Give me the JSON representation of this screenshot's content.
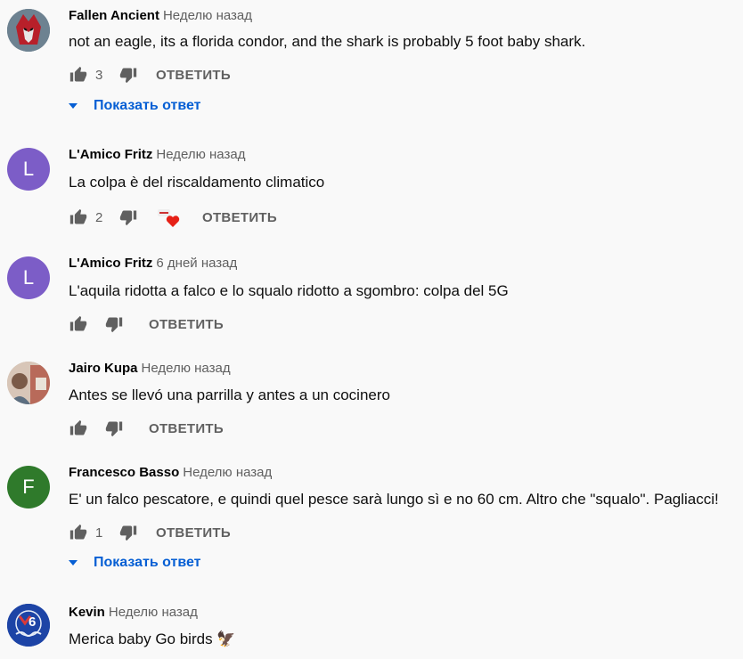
{
  "comments": [
    {
      "author": "Fallen Ancient",
      "time": "Неделю назад",
      "text": "not an eagle, its a florida condor, and the shark is probably 5 foot baby shark.",
      "likes": "3",
      "reply_label": "ОТВЕТИТЬ",
      "show_replies": "Показать ответ",
      "avatar_icon": "robot-mask-avatar-icon"
    },
    {
      "author": "L'Amico Fritz",
      "time": "Неделю назад",
      "text": "La colpa è del riscaldamento climatico",
      "likes": "2",
      "reply_label": "ОТВЕТИТЬ",
      "avatar_letter": "L",
      "avatar_color": "#7c5dc7",
      "creator_heart": true
    },
    {
      "author": "L'Amico Fritz",
      "time": "6 дней назад",
      "text": "L'aquila ridotta a falco e lo squalo ridotto a sgombro: colpa del 5G",
      "likes": "",
      "reply_label": "ОТВЕТИТЬ",
      "avatar_letter": "L",
      "avatar_color": "#7c5dc7"
    },
    {
      "author": "Jairo Kupa",
      "time": "Неделю назад",
      "text": "Antes se llevó una parrilla y antes a un cocinero",
      "likes": "",
      "reply_label": "ОТВЕТИТЬ",
      "avatar_icon": "photo-avatar-icon"
    },
    {
      "author": "Francesco Basso",
      "time": "Неделю назад",
      "text": "E' un falco pescatore, e quindi quel pesce sarà lungo sì e no 60 cm. Altro che \"squalo\". Pagliacci!",
      "likes": "1",
      "reply_label": "ОТВЕТИТЬ",
      "show_replies": "Показать ответ",
      "avatar_letter": "F",
      "avatar_color": "#2f7a2b"
    },
    {
      "author": "Kevin",
      "time": "Неделю назад",
      "text": "Merica baby Go birds 🦅",
      "avatar_icon": "76ers-logo-avatar-icon",
      "avatar_text": "6"
    }
  ],
  "colors": {
    "background": "#f9f9f9",
    "link_blue": "#065fd4",
    "secondary_text": "#606060",
    "heart_red": "#e62117"
  }
}
